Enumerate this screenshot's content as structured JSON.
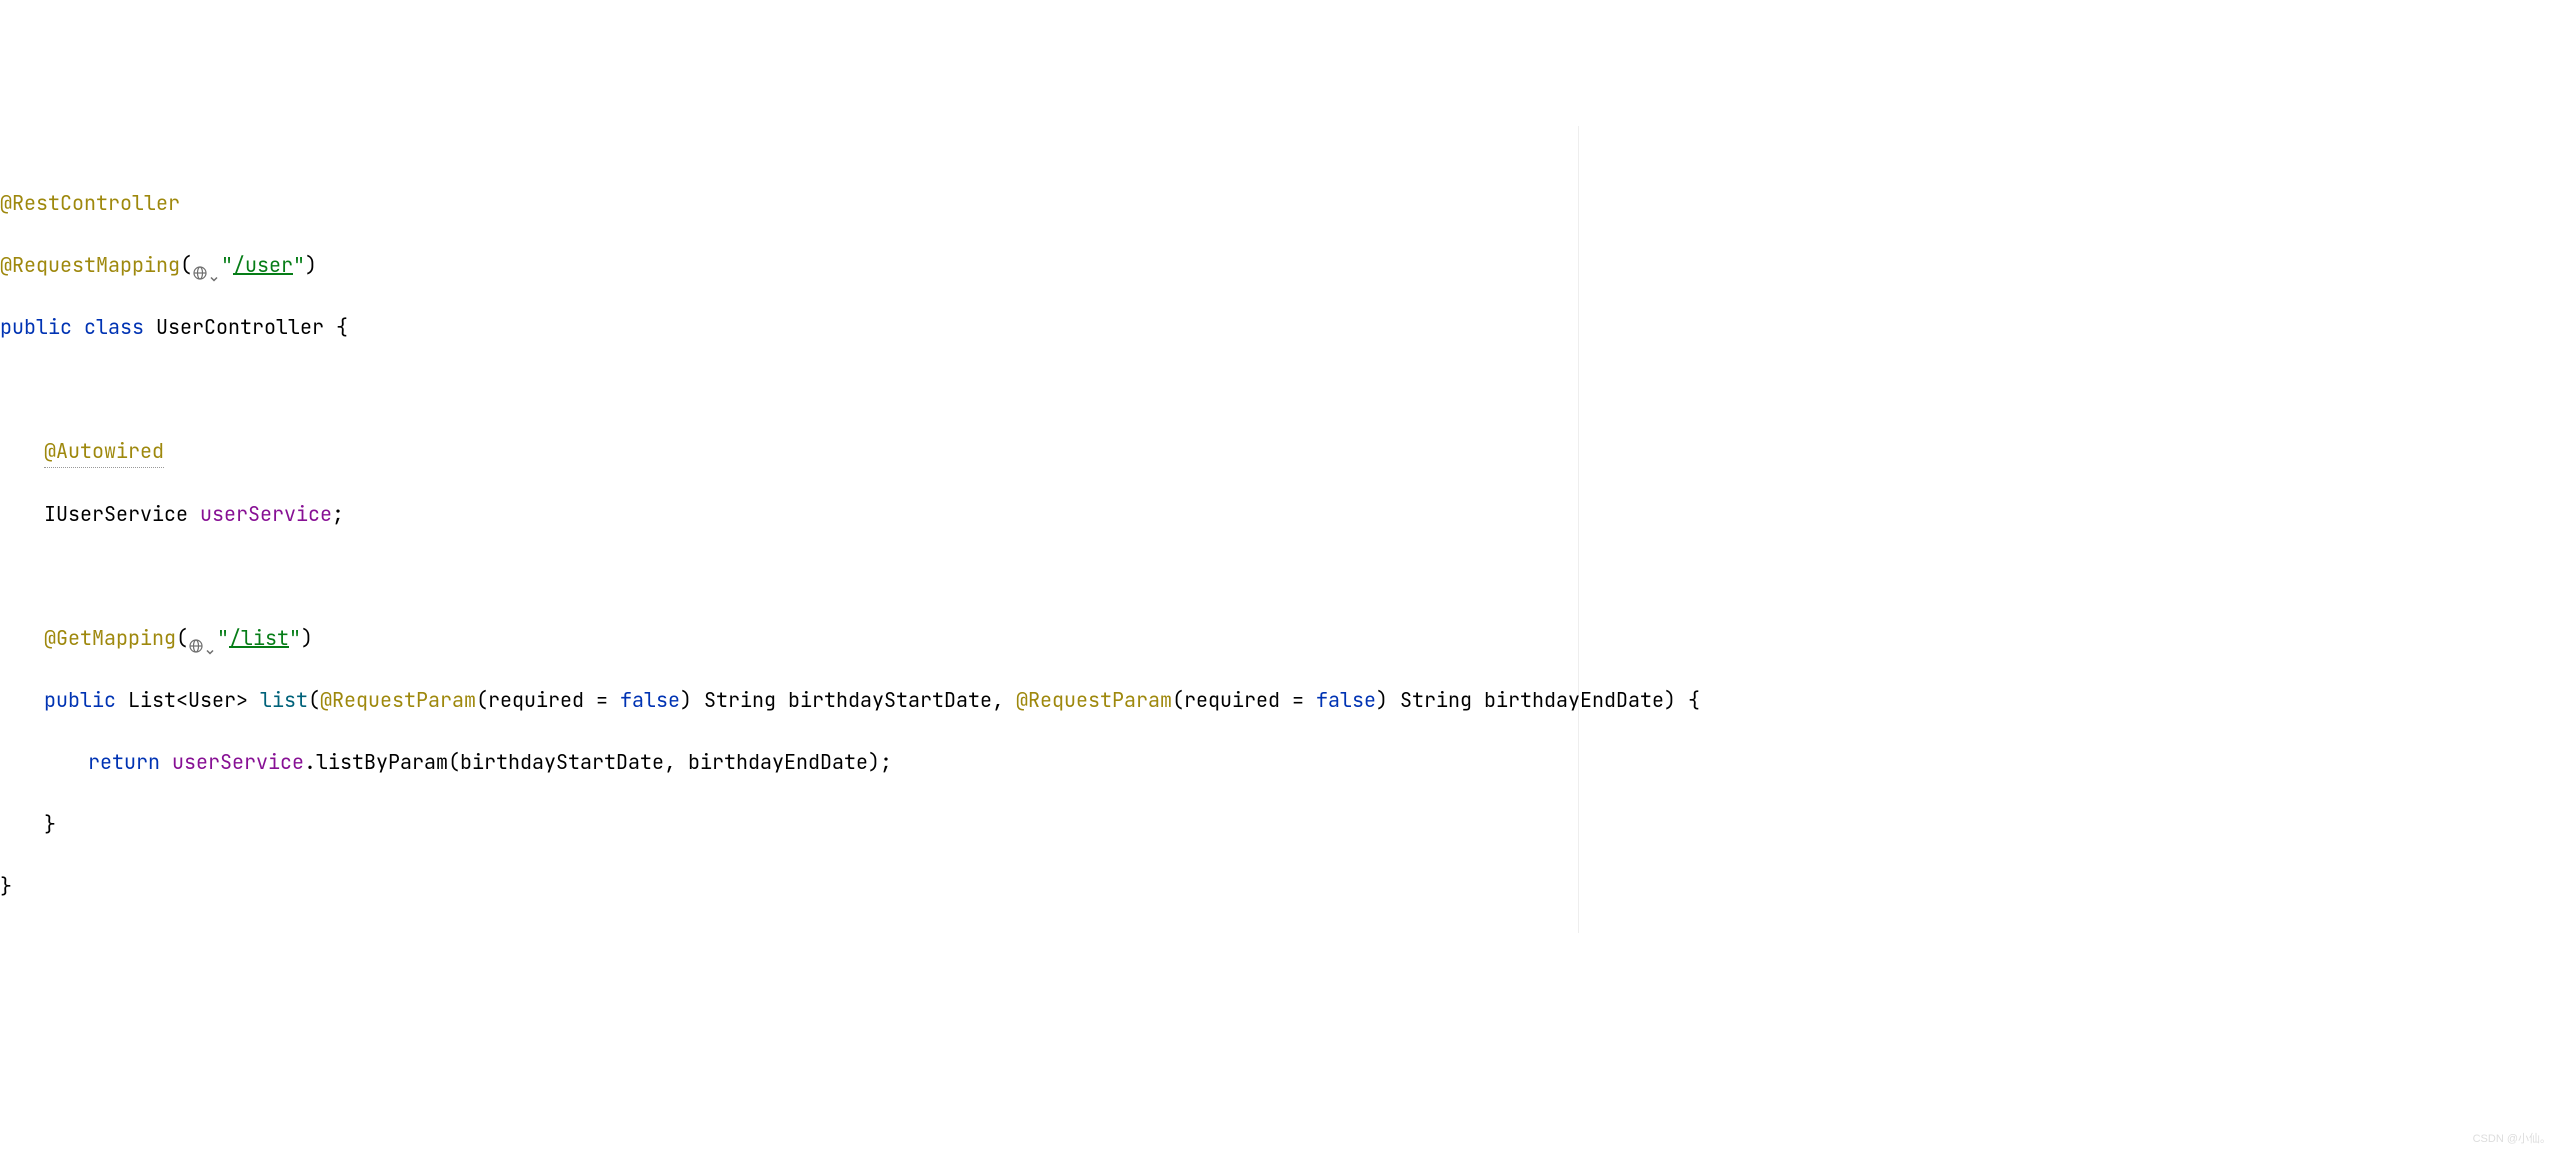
{
  "code": {
    "line1": {
      "annotation": "@RestController"
    },
    "line2": {
      "annotation": "@RequestMapping",
      "paren_open": "(",
      "string_quote1": "\"",
      "string_path": "/user",
      "string_quote2": "\"",
      "paren_close": ")"
    },
    "line3": {
      "kw_public": "public",
      "kw_class": "class",
      "class_name": "UserController",
      "brace": " {"
    },
    "line5": {
      "annotation": "@Autowired"
    },
    "line6": {
      "type": "IUserService",
      "field": "userService",
      "semi": ";"
    },
    "line8": {
      "annotation": "@GetMapping",
      "paren_open": "(",
      "string_quote1": "\"",
      "string_path": "/list",
      "string_quote2": "\"",
      "paren_close": ")"
    },
    "line9": {
      "kw_public": "public",
      "return_type1": "List",
      "angle_open": "<",
      "return_type2": "User",
      "angle_close": ">",
      "method": "list",
      "po": "(",
      "anno1": "@RequestParam",
      "p1o": "(",
      "param_req1": "required",
      "eq1": " = ",
      "false1": "false",
      "p1c": ")",
      "param_type1": " String ",
      "param_name1": "birthdayStartDate",
      "comma": ", ",
      "anno2": "@RequestParam",
      "p2o": "(",
      "param_req2": "required",
      "eq2": " = ",
      "false2": "false",
      "p2c": ")",
      "param_type2": " String ",
      "param_name2": "birthdayEndDate",
      "pc": ")",
      "brace": " {"
    },
    "line10": {
      "kw_return": "return",
      "obj": "userService",
      "dot": ".",
      "call": "listByParam",
      "po": "(",
      "arg1": "birthdayStartDate",
      "comma": ", ",
      "arg2": "birthdayEndDate",
      "pc": ")",
      "semi": ";"
    },
    "line11": {
      "brace": "}"
    },
    "line12": {
      "brace": "}"
    }
  },
  "watermark": "CSDN @小仙。"
}
